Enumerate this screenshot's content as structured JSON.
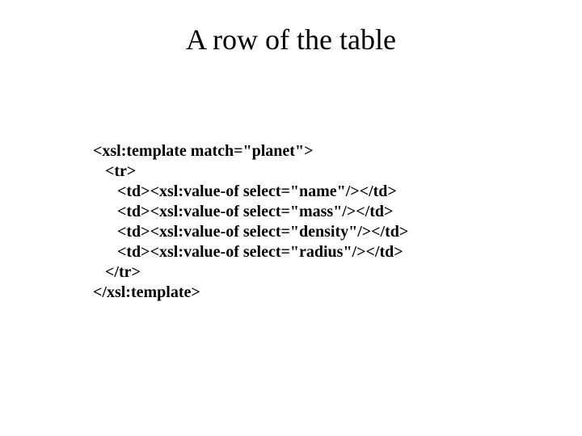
{
  "title": "A row of the table",
  "code": {
    "l1": "<xsl:template match=\"planet\">",
    "l2": "   <tr>",
    "l3": "      <td><xsl:value-of select=\"name\"/></td>",
    "l4": "      <td><xsl:value-of select=\"mass\"/></td>",
    "l5": "      <td><xsl:value-of select=\"density\"/></td>",
    "l6": "      <td><xsl:value-of select=\"radius\"/></td>",
    "l7": "   </tr>",
    "l8": "</xsl:template>"
  }
}
